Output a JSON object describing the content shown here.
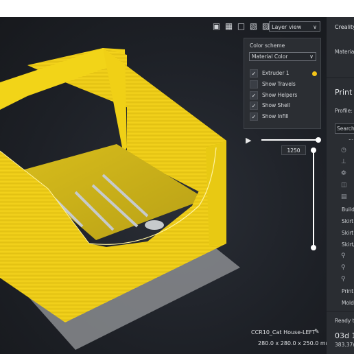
{
  "toolbar": {
    "icons": [
      "cube-icon",
      "cube-front-icon",
      "cube-top-icon",
      "cube-left-icon",
      "cube-right-icon"
    ],
    "view_select": "Layer view"
  },
  "color_panel": {
    "heading": "Color scheme",
    "scheme_value": "Material Color",
    "items": [
      {
        "label": "Extruder 1",
        "checked": true
      },
      {
        "label": "Show Travels",
        "checked": false
      },
      {
        "label": "Show Helpers",
        "checked": true
      },
      {
        "label": "Show Shell",
        "checked": true
      },
      {
        "label": "Show Infill",
        "checked": true
      }
    ],
    "extruder_color": "#f5c518"
  },
  "layer": {
    "value": "1250"
  },
  "object": {
    "name": "CCR10_Cat House-LEFT",
    "dimensions": "280.0 x 280.0 x 250.0 mm"
  },
  "sidebar": {
    "printer": "Creality",
    "material_label": "Material",
    "print_settings_title": "Print S",
    "profile_label": "Profile:",
    "search_placeholder": "Search..",
    "ellipsis": "...",
    "setting_rows": [
      "Build",
      "Skirt",
      "Skirt",
      "Skirt/",
      "Print",
      "Mold"
    ],
    "ready_label": "Ready t",
    "time_label": "03d 1",
    "material_usage": "383.37m"
  },
  "colors": {
    "model_yellow": "#f5d21a",
    "accent": "#f5c518"
  }
}
